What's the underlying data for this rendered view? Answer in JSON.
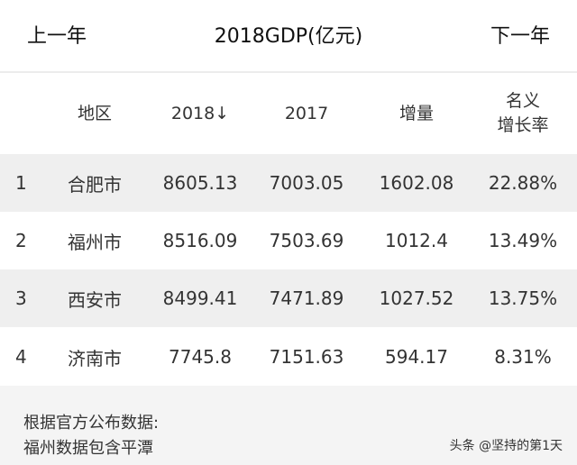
{
  "topbar": {
    "prev_label": "上一年",
    "title": "2018GDP(亿元)",
    "next_label": "下一年"
  },
  "table": {
    "headers": {
      "rank": "",
      "region": "地区",
      "y2018": "2018↓",
      "y2017": "2017",
      "increase": "增量",
      "rate_line1": "名义",
      "rate_line2": "增长率"
    },
    "sort": {
      "column": "2018",
      "direction": "desc",
      "icon": "arrow-down-icon"
    },
    "rows": [
      {
        "rank": "1",
        "region": "合肥市",
        "y2018": "8605.13",
        "y2017": "7003.05",
        "increase": "1602.08",
        "rate": "22.88%"
      },
      {
        "rank": "2",
        "region": "福州市",
        "y2018": "8516.09",
        "y2017": "7503.69",
        "increase": "1012.4",
        "rate": "13.49%"
      },
      {
        "rank": "3",
        "region": "西安市",
        "y2018": "8499.41",
        "y2017": "7471.89",
        "increase": "1027.52",
        "rate": "13.75%"
      },
      {
        "rank": "4",
        "region": "济南市",
        "y2018": "7745.8",
        "y2017": "7151.63",
        "increase": "594.17",
        "rate": "8.31%"
      }
    ]
  },
  "footer": {
    "note_line1": "根据官方公布数据:",
    "note_line2": "福州数据包含平潭",
    "watermark": "头条 @坚持的第1天"
  },
  "colors": {
    "row_shaded": "#efefef",
    "row_plain": "#ffffff",
    "footer_bg": "#f4f4f4",
    "divider": "#ececec"
  }
}
